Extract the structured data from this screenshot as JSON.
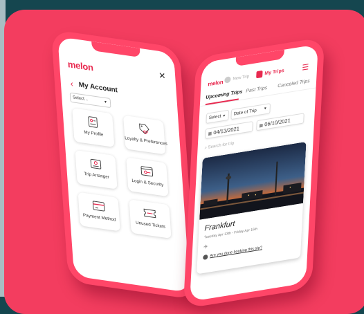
{
  "colors": {
    "brand": "#e8294f",
    "background": "#15464f",
    "card": "#f33d5f"
  },
  "left_phone": {
    "logo": "melon",
    "close_label": "✕",
    "title": "My Account",
    "select_label": "Select...",
    "tiles": [
      {
        "label": "My Profile",
        "icon": "profile-icon"
      },
      {
        "label": "Loyalty & Preferences",
        "icon": "loyalty-tag-icon"
      },
      {
        "label": "Trip Arranger",
        "icon": "trip-arranger-icon"
      },
      {
        "label": "Login & Security",
        "icon": "login-security-icon"
      },
      {
        "label": "Payment Method",
        "icon": "credit-card-icon"
      },
      {
        "label": "Unused Tickets",
        "icon": "ticket-icon"
      }
    ]
  },
  "right_phone": {
    "logo": "melon",
    "new_trip_label": "New Trip",
    "my_trips_label": "My Trips",
    "tabs": [
      "Upcoming Trips",
      "Past Trips",
      "Canceled Trips"
    ],
    "select_label": "Select",
    "date_filter_label": "Date of Trip",
    "start_date": "04/13/2021",
    "end_date": "06/10/2021",
    "search_placeholder": "Search for trip",
    "trip": {
      "city": "Frankfurt",
      "dates": "Tuesday Apr 13th - Friday Apr 16th",
      "question": "Are you done booking this trip?"
    }
  }
}
